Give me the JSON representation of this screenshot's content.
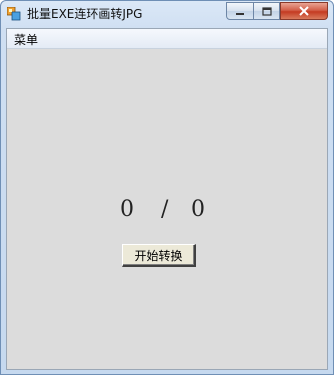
{
  "window": {
    "title": "批量EXE连环画转JPG",
    "colors": {
      "client_bg": "#dcdcdc",
      "close_red": "#c43b22",
      "frame_blue": "#cfdff2"
    }
  },
  "titlebar_icons": {
    "app": "app-icon",
    "minimize": "minimize-icon",
    "maximize": "maximize-icon",
    "close": "close-icon"
  },
  "menu": {
    "items": [
      "菜单"
    ]
  },
  "progress": {
    "current": "0",
    "separator": "/",
    "total": "0"
  },
  "actions": {
    "start_label": "开始转换"
  }
}
